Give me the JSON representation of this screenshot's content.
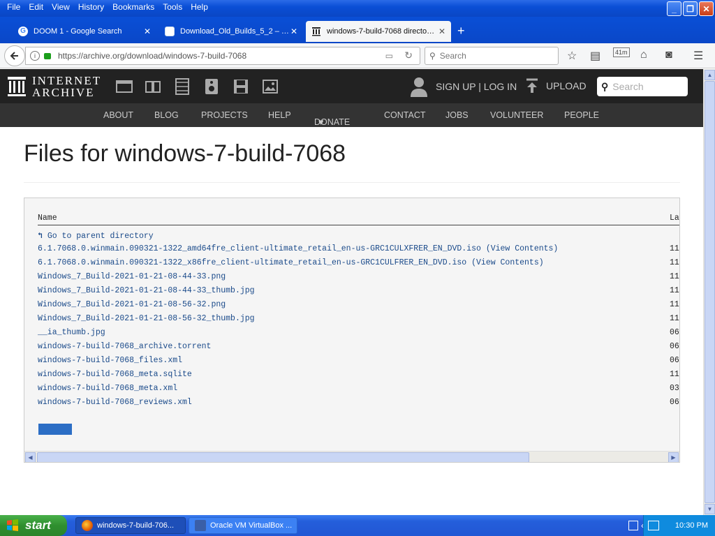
{
  "window": {
    "menus": [
      "File",
      "Edit",
      "View",
      "History",
      "Bookmarks",
      "Tools",
      "Help"
    ],
    "controls": {
      "minimize": "_",
      "maximize": "❐",
      "close": "✕"
    }
  },
  "tabs": [
    {
      "label": "DOOM 1 - Google Search",
      "close": "✕"
    },
    {
      "label": "Download_Old_Builds_5_2 – …",
      "close": "✕"
    },
    {
      "label": "windows-7-build-7068 directo…",
      "close": "✕"
    }
  ],
  "new_tab": "+",
  "nav": {
    "url": "https://archive.org/download/windows-7-build-7068",
    "search_placeholder": "Search",
    "timer": "41m"
  },
  "ia": {
    "logo_line1": "INTERNET",
    "logo_line2": "ARCHIVE",
    "signup": "SIGN UP | LOG IN",
    "upload": "UPLOAD",
    "search_placeholder": "Search",
    "menu": [
      "ABOUT",
      "BLOG",
      "PROJECTS",
      "HELP",
      "DONATE",
      "CONTACT",
      "JOBS",
      "VOLUNTEER",
      "PEOPLE"
    ],
    "donate_heart": "♥"
  },
  "main": {
    "title": "Files for windows-7-build-7068",
    "col_name": "Name",
    "col_date": "La",
    "parent": "Go to parent directory",
    "files": [
      {
        "name": "6.1.7068.0.winmain.090321-1322_amd64fre_client-ultimate_retail_en-us-GRC1CULXFRER_EN_DVD.iso",
        "extra": "(View Contents)",
        "date": "11"
      },
      {
        "name": "6.1.7068.0.winmain.090321-1322_x86fre_client-ultimate_retail_en-us-GRC1CULFRER_EN_DVD.iso",
        "extra": "(View Contents)",
        "date": "11"
      },
      {
        "name": "Windows_7_Build-2021-01-21-08-44-33.png",
        "extra": "",
        "date": "11"
      },
      {
        "name": "Windows_7_Build-2021-01-21-08-44-33_thumb.jpg",
        "extra": "",
        "date": "11"
      },
      {
        "name": "Windows_7_Build-2021-01-21-08-56-32.png",
        "extra": "",
        "date": "11"
      },
      {
        "name": "Windows_7_Build-2021-01-21-08-56-32_thumb.jpg",
        "extra": "",
        "date": "11"
      },
      {
        "name": "__ia_thumb.jpg",
        "extra": "",
        "date": "06"
      },
      {
        "name": "windows-7-build-7068_archive.torrent",
        "extra": "",
        "date": "06"
      },
      {
        "name": "windows-7-build-7068_files.xml",
        "extra": "",
        "date": "06"
      },
      {
        "name": "windows-7-build-7068_meta.sqlite",
        "extra": "",
        "date": "11"
      },
      {
        "name": "windows-7-build-7068_meta.xml",
        "extra": "",
        "date": "03"
      },
      {
        "name": "windows-7-build-7068_reviews.xml",
        "extra": "",
        "date": "06"
      }
    ]
  },
  "taskbar": {
    "start": "start",
    "items": [
      {
        "label": "windows-7-build-706..."
      },
      {
        "label": "Oracle VM VirtualBox ..."
      }
    ],
    "clock": "10:30 PM"
  },
  "colors": {
    "ia_dark": "#222222",
    "ia_nav": "#333333",
    "link_blue": "#1a4a8a",
    "xp_blue": "#0a4fd6",
    "start_green": "#2f8f2f"
  }
}
